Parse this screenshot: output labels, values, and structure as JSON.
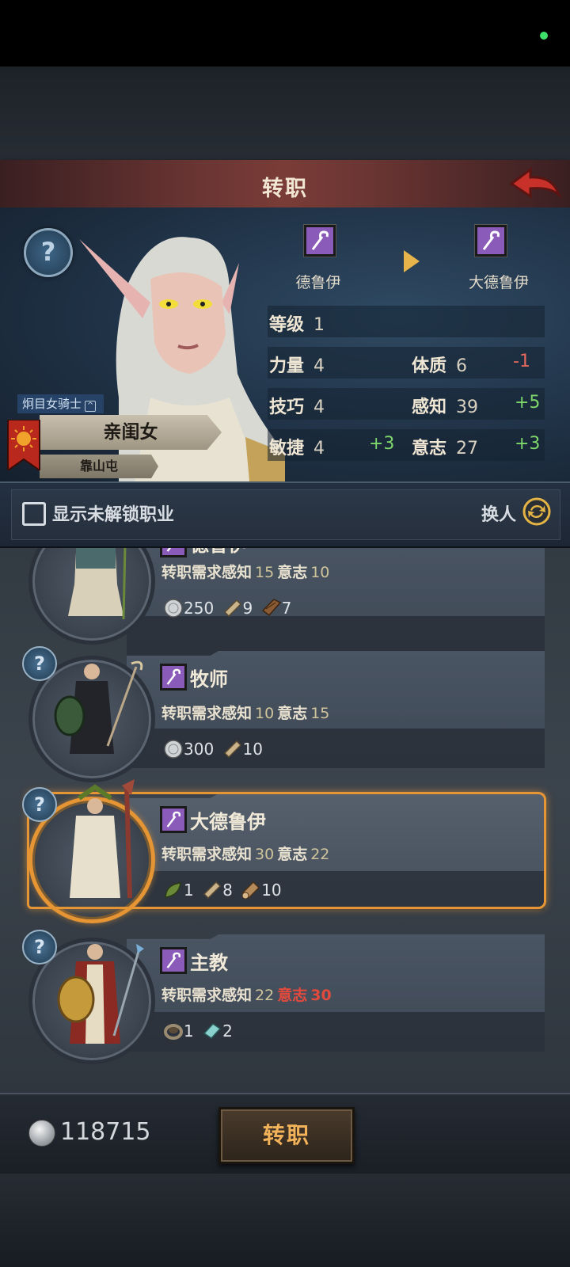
{
  "header": {
    "title": "转职"
  },
  "hero": {
    "class_tag": "炯目女骑士",
    "name": "亲闺女",
    "origin": "靠山屯",
    "current_job": "德鲁伊",
    "target_job": "大德鲁伊",
    "level_label": "等级",
    "level_value": "1",
    "stats": {
      "str_label": "力量",
      "str_value": "4",
      "con_label": "体质",
      "con_value": "6",
      "con_delta": "-1",
      "skill_label": "技巧",
      "skill_value": "4",
      "per_label": "感知",
      "per_value": "39",
      "per_delta": "+5",
      "agi_label": "敏捷",
      "agi_value": "4",
      "agi_delta": "+3",
      "will_label": "意志",
      "will_value": "27",
      "will_delta": "+3"
    }
  },
  "filter": {
    "label": "显示未解锁职业",
    "swap_label": "换人"
  },
  "jobs": [
    {
      "title": "德鲁伊",
      "req_label": "转职需求感知",
      "req_per": "15",
      "req_will_label": "意志",
      "req_will": "10",
      "mats": [
        "250",
        "9",
        "7"
      ]
    },
    {
      "title": "牧师",
      "req_label": "转职需求感知",
      "req_per": "10",
      "req_will_label": "意志",
      "req_will": "15",
      "mats": [
        "300",
        "10"
      ]
    },
    {
      "title": "大德鲁伊",
      "req_label": "转职需求感知",
      "req_per": "30",
      "req_will_label": "意志",
      "req_will": "22",
      "mats": [
        "1",
        "8",
        "10"
      ]
    },
    {
      "title": "主教",
      "req_label": "转职需求感知",
      "req_per": "22",
      "req_will_label": "意志",
      "req_will": "30",
      "mats": [
        "1",
        "2"
      ]
    }
  ],
  "help_mark": "?",
  "footer": {
    "coins": "118715",
    "confirm_label": "转职"
  },
  "colors": {
    "accent": "#e59534",
    "job_purple": "#8a5bb8",
    "positive": "#7fd66a",
    "negative": "#e36a5c",
    "button_text": "#f1b25a"
  },
  "icons": [
    "back-arrow-icon",
    "staff-icon",
    "help-icon",
    "swap-icon",
    "silver-coin-icon",
    "scroll-icon",
    "wood-plank-icon",
    "leaf-icon",
    "log-icon",
    "ring-icon",
    "crystal-icon"
  ]
}
